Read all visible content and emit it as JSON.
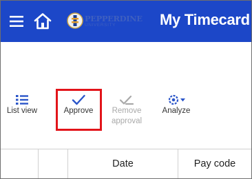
{
  "colors": {
    "header_bg": "#1c47c8",
    "icon_blue": "#2a55c9",
    "disabled": "#a9a9a9",
    "highlight": "#e2141a"
  },
  "header": {
    "menu_icon": "hamburger-menu-icon",
    "home_icon": "home-icon",
    "logo_name": "PEPPERDINE",
    "logo_sub": "UNIVERSITY",
    "title": "My Timecard"
  },
  "toolbar": {
    "list_view": {
      "label": "List view",
      "icon": "list-view-icon"
    },
    "approve": {
      "label": "Approve",
      "icon": "checkmark-icon",
      "highlighted": true
    },
    "remove_approval": {
      "label_line1": "Remove",
      "label_line2": "approval",
      "icon": "remove-approval-icon",
      "disabled": true
    },
    "analyze": {
      "label": "Analyze",
      "icon": "analyze-gear-icon"
    }
  },
  "table": {
    "columns": [
      "",
      "",
      "Date",
      "Pay code"
    ]
  }
}
